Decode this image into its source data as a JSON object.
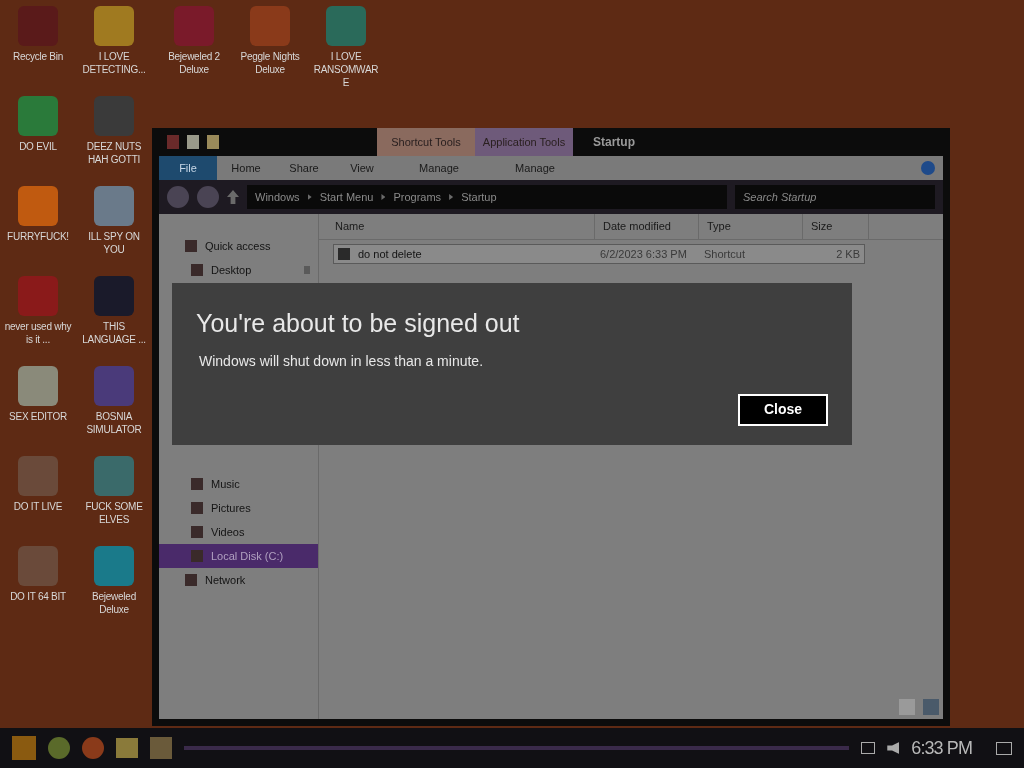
{
  "desktop_icons": [
    {
      "label": "Recycle Bin",
      "color": "#5a1a1a"
    },
    {
      "label": "DO EVIL",
      "color": "#2a7a3a"
    },
    {
      "label": "FURRYFUCK!",
      "color": "#c05a10"
    },
    {
      "label": "never used why is it ...",
      "color": "#8a1a1a"
    },
    {
      "label": "SEX EDITOR",
      "color": "#8a8a7a"
    },
    {
      "label": "DO IT LIVE",
      "color": "#6a4a3a"
    },
    {
      "label": "DO IT 64 BIT",
      "color": "#6a4a3a"
    },
    {
      "label": "I LOVE DETECTING...",
      "color": "#a07a20"
    },
    {
      "label": "DEEZ NUTS HAH GOTTI",
      "color": "#3a3a3a"
    },
    {
      "label": "ILL SPY ON YOU",
      "color": "#6a7a8a"
    },
    {
      "label": "THIS LANGUAGE ...",
      "color": "#1a1a2a"
    },
    {
      "label": "BOSNIA SIMULATOR",
      "color": "#4a3a7a"
    },
    {
      "label": "FUCK SOME ELVES",
      "color": "#3a6a6a"
    },
    {
      "label": "Bejeweled Deluxe",
      "color": "#1a7a8a"
    },
    {
      "label": "Bejeweled 2 Deluxe",
      "color": "#7a1a2a"
    },
    {
      "label": "Peggle Nights Deluxe",
      "color": "#8a3a1a"
    },
    {
      "label": "I LOVE RANSOMWARE",
      "color": "#2a6a5a"
    }
  ],
  "explorer": {
    "title": "Startup",
    "context_tabs": [
      {
        "label": "Shortcut Tools",
        "color": "#8a6a5e"
      },
      {
        "label": "Application Tools",
        "color": "#6e5a7a"
      }
    ],
    "ribbon_tabs": [
      {
        "label": "File",
        "selected": true
      },
      {
        "label": "Home",
        "selected": false
      },
      {
        "label": "Share",
        "selected": false
      },
      {
        "label": "View",
        "selected": false
      },
      {
        "label": "Manage",
        "selected": false
      },
      {
        "label": "Manage",
        "selected": false
      }
    ],
    "breadcrumb": [
      "Windows",
      "Start Menu",
      "Programs",
      "Startup"
    ],
    "search": {
      "placeholder": "Search Startup"
    },
    "nav": [
      {
        "label": "Quick access",
        "selected": false,
        "pinned": false
      },
      {
        "label": "Desktop",
        "selected": false,
        "pinned": true
      },
      {
        "label": "Music",
        "selected": false,
        "pinned": false
      },
      {
        "label": "Pictures",
        "selected": false,
        "pinned": false
      },
      {
        "label": "Videos",
        "selected": false,
        "pinned": false
      },
      {
        "label": "Local Disk (C:)",
        "selected": true,
        "pinned": false
      },
      {
        "label": "Network",
        "selected": false,
        "pinned": false
      }
    ],
    "columns": [
      "Name",
      "Date modified",
      "Type",
      "Size"
    ],
    "rows": [
      {
        "cells": [
          "do not delete",
          "6/2/2023 6:33 PM",
          "Shortcut",
          "2 KB"
        ],
        "selected": true
      }
    ]
  },
  "dialog": {
    "title": "You're about to be signed out",
    "message": "Windows will shut down in less than a minute.",
    "button": "Close"
  },
  "taskbar": {
    "clock": "6:33 PM"
  }
}
